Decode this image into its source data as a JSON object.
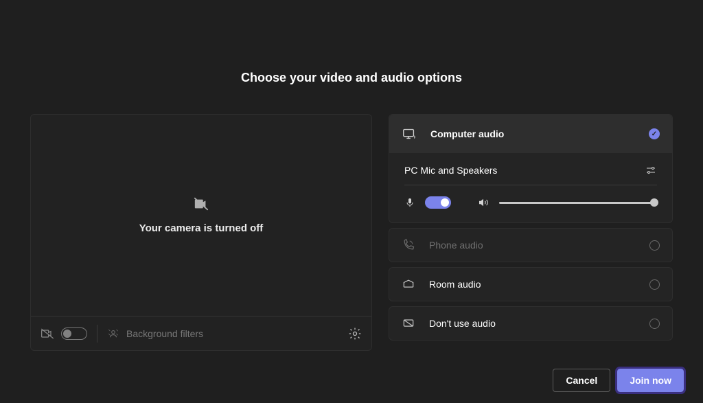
{
  "title": "Choose your video and audio options",
  "camera": {
    "status_text": "Your camera is turned off"
  },
  "background_filters": {
    "label": "Background filters"
  },
  "audio_options": {
    "computer": {
      "label": "Computer audio"
    },
    "phone": {
      "label": "Phone audio"
    },
    "room": {
      "label": "Room audio"
    },
    "none": {
      "label": "Don't use audio"
    }
  },
  "audio_device": {
    "name": "PC Mic and Speakers"
  },
  "buttons": {
    "cancel": "Cancel",
    "join": "Join now"
  }
}
